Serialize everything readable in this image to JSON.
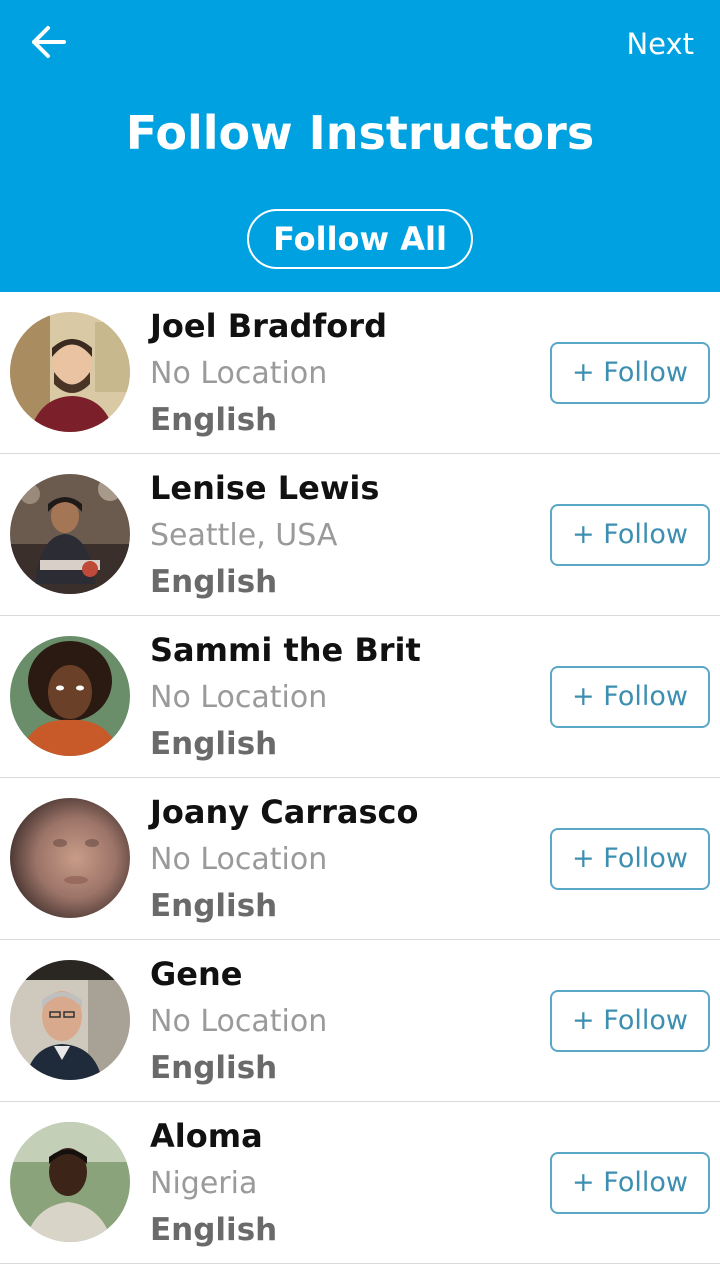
{
  "header": {
    "next_label": "Next",
    "title": "Follow Instructors",
    "follow_all_label": "Follow All",
    "background_color": "#00a1e0"
  },
  "follow_button_label": "+ Follow",
  "instructors": [
    {
      "name": "Joel Bradford",
      "location": "No Location",
      "language": "English"
    },
    {
      "name": "Lenise Lewis",
      "location": "Seattle, USA",
      "language": "English"
    },
    {
      "name": "Sammi the Brit",
      "location": "No Location",
      "language": "English"
    },
    {
      "name": "Joany Carrasco",
      "location": "No Location",
      "language": "English"
    },
    {
      "name": "Gene",
      "location": "No Location",
      "language": "English"
    },
    {
      "name": "Aloma",
      "location": "Nigeria",
      "language": "English"
    }
  ]
}
